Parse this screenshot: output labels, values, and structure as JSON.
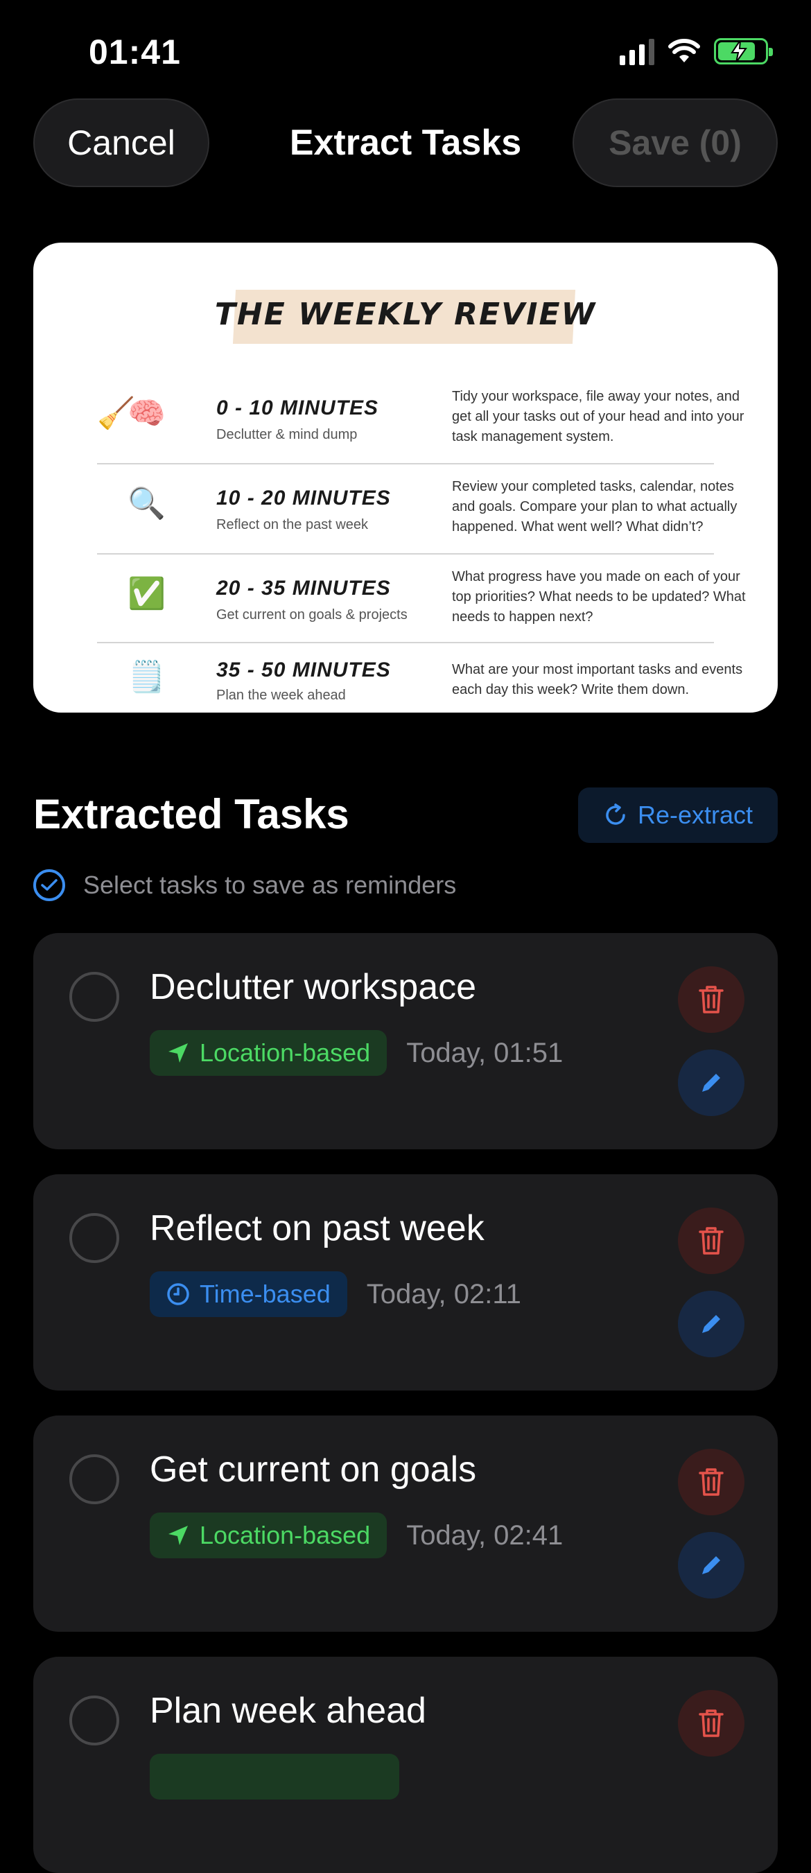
{
  "status_bar": {
    "time": "01:41",
    "icons": [
      "cellular-signal-icon",
      "wifi-icon",
      "battery-charging-icon"
    ]
  },
  "header": {
    "cancel_label": "Cancel",
    "title": "Extract Tasks",
    "save_label": "Save (0)"
  },
  "preview": {
    "title": "THE WEEKLY REVIEW",
    "rows": [
      {
        "icons": [
          "broom-icon",
          "brain-icon"
        ],
        "range": "0 - 10 MINUTES",
        "subtitle": "Declutter & mind dump",
        "description": "Tidy your workspace, file away your notes, and get all your tasks out of your head and into your task management system."
      },
      {
        "icons": [
          "magnifier-icon"
        ],
        "range": "10 - 20 MINUTES",
        "subtitle": "Reflect on the past week",
        "description": "Review your completed tasks, calendar, notes and goals. Compare your plan to what actually happened. What went well? What didn’t?"
      },
      {
        "icons": [
          "check-box-icon"
        ],
        "range": "20 - 35 MINUTES",
        "subtitle": "Get current on goals & projects",
        "description": "What progress have you made on each of your top priorities? What needs to be updated? What needs to happen next?"
      },
      {
        "icons": [
          "notepad-icon"
        ],
        "range": "35 - 50 MINUTES",
        "subtitle": "Plan the week ahead",
        "description": "What are your most important tasks and events each day this week? Write them down."
      }
    ]
  },
  "section": {
    "title": "Extracted Tasks",
    "reextract_label": "Re-extract",
    "hint": "Select tasks to save as reminders"
  },
  "tasks": [
    {
      "title": "Declutter workspace",
      "tag": "Location-based",
      "tag_type": "location",
      "time": "Today, 01:51"
    },
    {
      "title": "Reflect on past week",
      "tag": "Time-based",
      "tag_type": "time",
      "time": "Today, 02:11"
    },
    {
      "title": "Get current on goals",
      "tag": "Location-based",
      "tag_type": "location",
      "time": "Today, 02:41"
    },
    {
      "title": "Plan week ahead",
      "tag": "",
      "tag_type": "location",
      "time": ""
    }
  ],
  "colors": {
    "accent_blue": "#3b8ef0",
    "location_green": "#4cd964",
    "delete_red": "#e5534b",
    "card_bg": "#1c1c1e"
  }
}
